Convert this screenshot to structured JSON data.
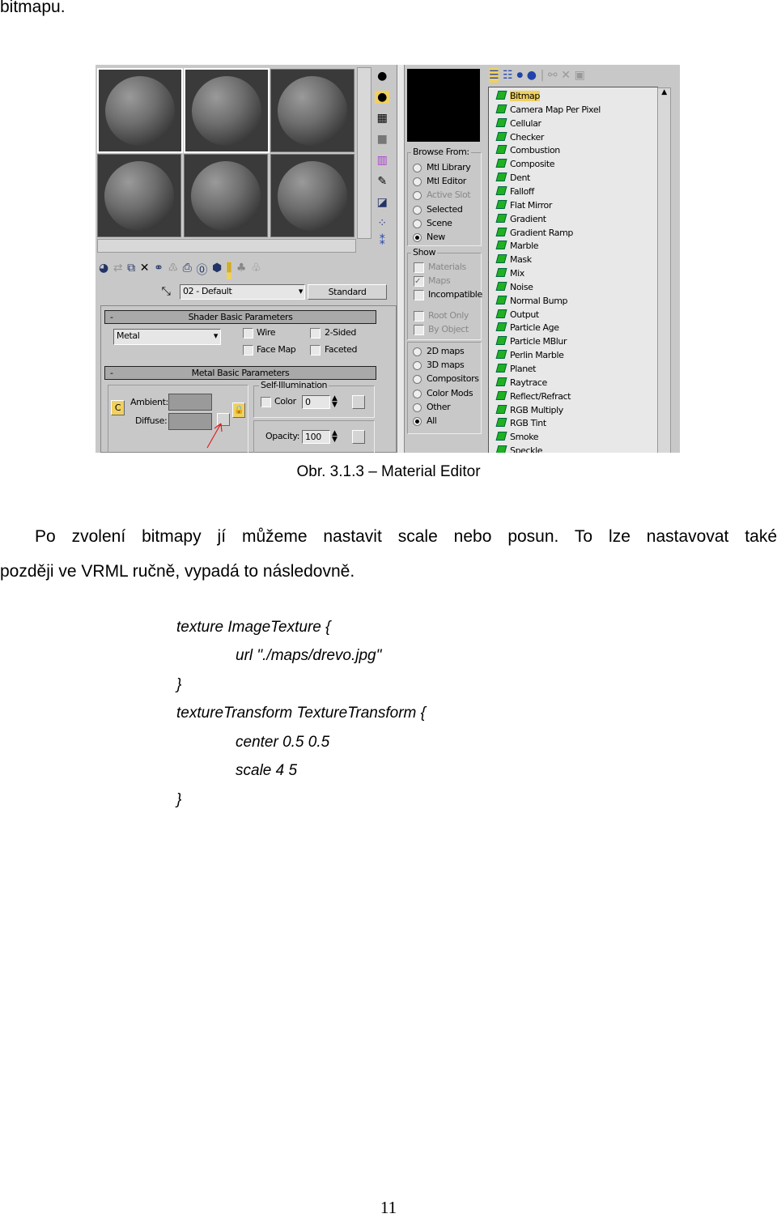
{
  "top_text": "bitmapu.",
  "figure": {
    "caption": "Obr. 3.1.3 – Material Editor",
    "material_name": "02 - Default",
    "material_type_button": "Standard",
    "shader_rollout": {
      "title": "Shader Basic Parameters",
      "collapse": "-",
      "shader": "Metal",
      "wire": "Wire",
      "two_sided": "2-Sided",
      "face_map": "Face Map",
      "faceted": "Faceted"
    },
    "metal_rollout": {
      "title": "Metal Basic Parameters",
      "collapse": "-",
      "ambient": "Ambient:",
      "diffuse": "Diffuse:",
      "lock_button": "C",
      "self_illum_title": "Self-Illumination",
      "color_label": "Color",
      "color_value": "0",
      "opacity_label": "Opacity:",
      "opacity_value": "100"
    },
    "browser": {
      "browse_from_title": "Browse From:",
      "browse_from": [
        {
          "label": "Mtl Library",
          "selected": false,
          "disabled": false
        },
        {
          "label": "Mtl Editor",
          "selected": false,
          "disabled": false
        },
        {
          "label": "Active Slot",
          "selected": false,
          "disabled": true
        },
        {
          "label": "Selected",
          "selected": false,
          "disabled": false
        },
        {
          "label": "Scene",
          "selected": false,
          "disabled": false
        },
        {
          "label": "New",
          "selected": true,
          "disabled": false
        }
      ],
      "show_title": "Show",
      "show": [
        {
          "label": "Materials",
          "checked": false,
          "disabled": true
        },
        {
          "label": "Maps",
          "checked": true,
          "disabled": true
        },
        {
          "label": "Incompatible",
          "checked": false,
          "disabled": false
        }
      ],
      "show2": [
        {
          "label": "Root Only",
          "checked": false,
          "disabled": true
        },
        {
          "label": "By Object",
          "checked": false,
          "disabled": true
        }
      ],
      "filter": [
        {
          "label": "2D maps",
          "selected": false
        },
        {
          "label": "3D maps",
          "selected": false
        },
        {
          "label": "Compositors",
          "selected": false
        },
        {
          "label": "Color Mods",
          "selected": false
        },
        {
          "label": "Other",
          "selected": false
        },
        {
          "label": "All",
          "selected": true
        }
      ],
      "maps": [
        "Bitmap",
        "Camera Map Per Pixel",
        "Cellular",
        "Checker",
        "Combustion",
        "Composite",
        "Dent",
        "Falloff",
        "Flat Mirror",
        "Gradient",
        "Gradient Ramp",
        "Marble",
        "Mask",
        "Mix",
        "Noise",
        "Normal Bump",
        "Output",
        "Particle Age",
        "Particle MBlur",
        "Perlin Marble",
        "Planet",
        "Raytrace",
        "Reflect/Refract",
        "RGB Multiply",
        "RGB Tint",
        "Smoke",
        "Speckle"
      ],
      "selected_map": "Bitmap"
    },
    "colors": {
      "highlight": "#f0d060",
      "map_icon": "#20b020",
      "arrow": "#e02020"
    }
  },
  "paragraph": {
    "line1": "Po zvolení bitmapy jí můžeme nastavit scale nebo posun. To lze nastavovat také",
    "line2": "později ve VRML ručně, vypadá to následovně."
  },
  "code": [
    "texture ImageTexture {",
    "url \"./maps/drevo.jpg\"",
    "}",
    "textureTransform TextureTransform {",
    "center 0.5 0.5",
    "scale 4 5",
    "}"
  ],
  "page_number": "11"
}
